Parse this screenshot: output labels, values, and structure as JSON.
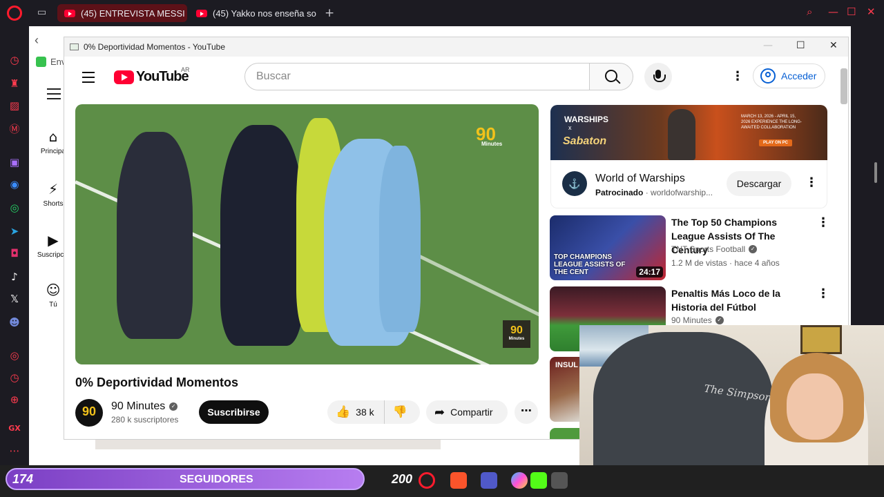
{
  "browser": {
    "tabs": [
      {
        "label": "(45) ENTREVISTA MESSI -",
        "active": true
      },
      {
        "label": "(45) Yakko nos enseña so",
        "active": false
      }
    ],
    "new_tab": "+",
    "accent": "#ff1b2d"
  },
  "background_page": {
    "envio_label": "Env",
    "nav_items": [
      {
        "label": "Principa",
        "icon": "home-icon"
      },
      {
        "label": "Shorts",
        "icon": "shorts-icon"
      },
      {
        "label": "Suscripcio",
        "icon": "subscriptions-icon"
      },
      {
        "label": "Tú",
        "icon": "you-icon"
      }
    ]
  },
  "popup": {
    "window_title": "0% Deportividad Momentos - YouTube",
    "logo_text": "YouTube",
    "region": "AR",
    "search_placeholder": "Buscar",
    "signin_label": "Acceder",
    "video": {
      "title": "0% Deportividad Momentos",
      "watermark": "90",
      "watermark_sub": "Minutes",
      "channel": "90 Minutes",
      "channel_avatar": "90",
      "subscribers": "280 k suscriptores",
      "subscribe_label": "Suscribirse",
      "likes": "38 k",
      "share_label": "Compartir"
    },
    "ad": {
      "banner_line1": "WARSHIPS",
      "banner_line2": "x",
      "banner_line3": "Sabaton",
      "banner_dates": "MARCH 13, 2026 - APRIL 15, 2026 EXPERIENCE THE LONG-AWAITED COLLABORATION",
      "banner_cta": "PLAY ON PC",
      "name": "World of Warships",
      "sponsored": "Patrocinado",
      "domain": "worldofwarship...",
      "cta": "Descargar"
    },
    "recommendations": [
      {
        "title": "The Top 50 Champions League Assists Of The Century",
        "channel": "TNT Sports Football",
        "meta": "1.2 M de vistas · hace 4 años",
        "duration": "24:17",
        "thumb_caption": "TOP CHAMPIONS LEAGUE ASSISTS OF THE CENT"
      },
      {
        "title": "Penaltis Más Loco de la Historia del Fútbol",
        "channel": "90 Minutes",
        "meta": "",
        "duration": "",
        "thumb_caption": ""
      },
      {
        "title": "",
        "channel": "",
        "meta": "",
        "duration": "",
        "thumb_caption": "INSUL"
      }
    ]
  },
  "overlay": {
    "followers_current": "174",
    "followers_label": "SEGUIDORES",
    "followers_goal": "200",
    "followers_progress": 0.87,
    "shirt_print": "The Simpsons"
  }
}
